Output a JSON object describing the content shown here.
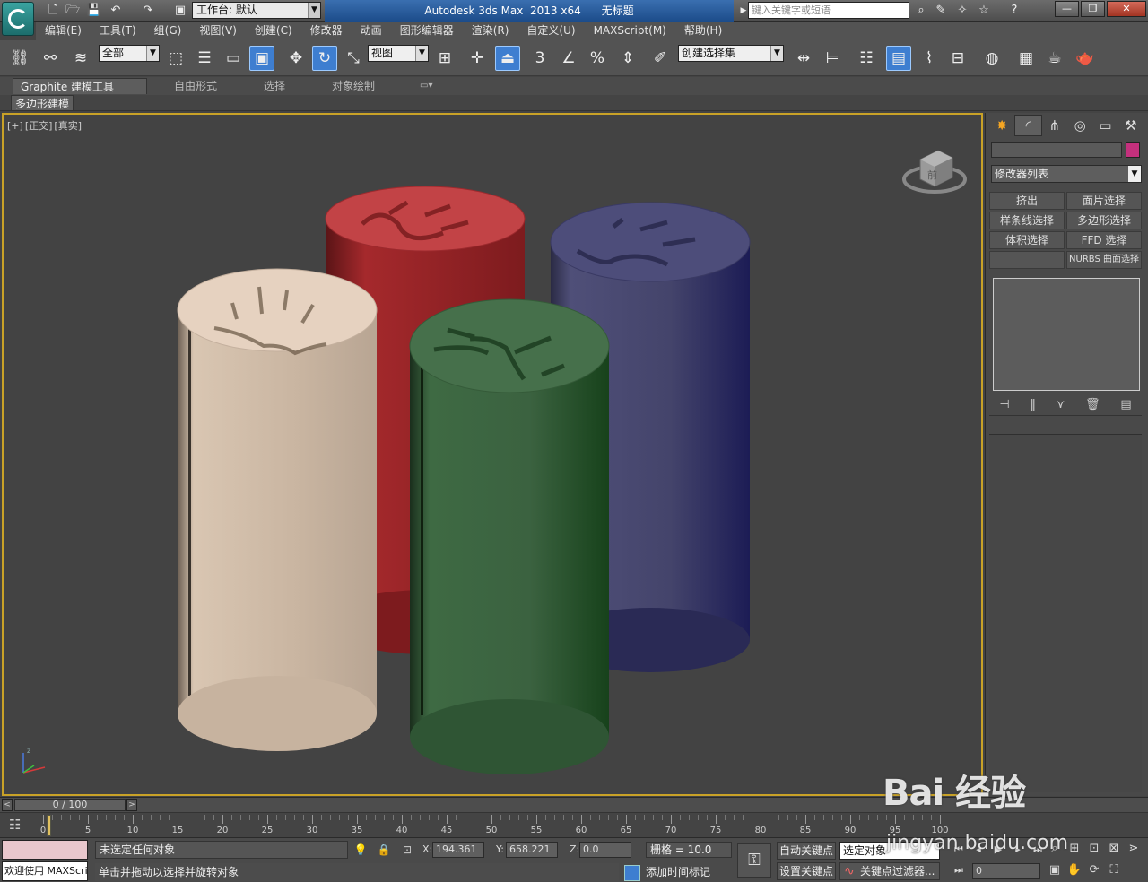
{
  "titlebar": {
    "workspace_label": "工作台: 默认",
    "app_title": "Autodesk 3ds Max  2013 x64      无标题",
    "search_placeholder": "键入关键字或短语"
  },
  "menubar": {
    "items": [
      "编辑(E)",
      "工具(T)",
      "组(G)",
      "视图(V)",
      "创建(C)",
      "修改器",
      "动画",
      "图形编辑器",
      "渲染(R)",
      "自定义(U)",
      "MAXScript(M)",
      "帮助(H)"
    ]
  },
  "toolbar": {
    "selection_filter": "全部",
    "reference_coord": "视图",
    "named_selection": "创建选择集",
    "snap_label": "3"
  },
  "ribbon": {
    "tabs": [
      "Graphite 建模工具",
      "自由形式",
      "选择",
      "对象绘制"
    ],
    "subtab": "多边形建模"
  },
  "viewport": {
    "labels": [
      "[+]",
      "[正交]",
      "[真实]"
    ],
    "viewcube_face": "前",
    "objects": [
      {
        "name": "beige-cylinder",
        "color": "#cdb8a3"
      },
      {
        "name": "red-cylinder",
        "color": "#b5373a"
      },
      {
        "name": "blue-cylinder",
        "color": "#3e3e72"
      },
      {
        "name": "green-cylinder",
        "color": "#3b5e3f"
      }
    ]
  },
  "command_panel": {
    "object_color": "#c4307d",
    "modifier_list": "修改器列表",
    "modifier_buttons": [
      "挤出",
      "面片选择",
      "样条线选择",
      "多边形选择",
      "体积选择",
      "FFD 选择",
      "",
      "NURBS 曲面选择"
    ]
  },
  "timeline": {
    "frame_display": "0 / 100",
    "ticks": [
      "0",
      "5",
      "10",
      "15",
      "20",
      "25",
      "30",
      "35",
      "40",
      "45",
      "50",
      "55",
      "60",
      "65",
      "70",
      "75",
      "80",
      "85",
      "90",
      "95",
      "100"
    ]
  },
  "statusbar": {
    "maxscript_output": "欢迎使用 MAXScri",
    "selection_status": "未选定任何对象",
    "prompt": "单击并拖动以选择并旋转对象",
    "x_label": "X:",
    "x_value": "194.361",
    "y_label": "Y:",
    "y_value": "658.221",
    "z_label": "Z:",
    "z_value": "0.0",
    "grid": "栅格 = 10.0",
    "add_time_tag": "添加时间标记",
    "auto_key": "自动关键点",
    "set_key": "设置关键点",
    "selected_object": "选定对象",
    "key_filters": "关键点过滤器...",
    "current_frame": "0"
  },
  "watermark": {
    "brand": "Bai 经验",
    "url": "jingyan.baidu.com"
  }
}
